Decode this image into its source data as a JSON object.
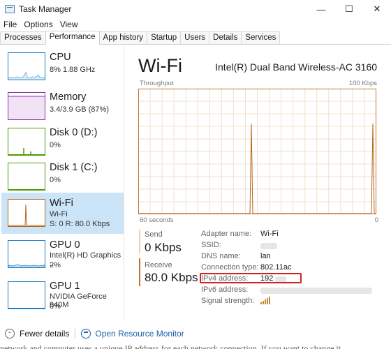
{
  "window": {
    "title": "Task Manager",
    "minimize_label": "—",
    "maximize_label": "☐",
    "close_label": "✕"
  },
  "menu": [
    "File",
    "Options",
    "View"
  ],
  "tabs": [
    "Processes",
    "Performance",
    "App history",
    "Startup",
    "Users",
    "Details",
    "Services"
  ],
  "active_tab": "Performance",
  "sidebar": {
    "items": [
      {
        "name": "CPU",
        "line1": "8%  1.88 GHz",
        "line2": "",
        "color": "#1f7fc6"
      },
      {
        "name": "Memory",
        "line1": "3.4/3.9 GB (87%)",
        "line2": "",
        "color": "#8b31a8"
      },
      {
        "name": "Disk 0 (D:)",
        "line1": "0%",
        "line2": "",
        "color": "#4e9a06"
      },
      {
        "name": "Disk 1 (C:)",
        "line1": "0%",
        "line2": "",
        "color": "#4e9a06"
      },
      {
        "name": "Wi-Fi",
        "line1": "Wi-Fi",
        "line2": "S: 0 R: 80.0 Kbps",
        "color": "#b5661a"
      },
      {
        "name": "GPU 0",
        "line1": "Intel(R) HD Graphics ...",
        "line2": "2%",
        "color": "#1f7fc6"
      },
      {
        "name": "GPU 1",
        "line1": "NVIDIA GeForce 940M",
        "line2": "0%",
        "color": "#1f7fc6"
      }
    ],
    "selected": "Wi-Fi"
  },
  "main": {
    "title": "Wi-Fi",
    "adapter": "Intel(R) Dual Band Wireless-AC 3160",
    "throughput_label": "Throughput",
    "throughput_max": "100 Kbps",
    "time_left": "60 seconds",
    "time_right": "0",
    "accent": "#c2742a",
    "grid_color": "#f1e0cc",
    "send_label": "Send",
    "send_value": "0 Kbps",
    "receive_label": "Receive",
    "receive_value": "80.0 Kbps",
    "properties": [
      {
        "key": "Adapter name:",
        "value": "Wi-Fi"
      },
      {
        "key": "SSID:",
        "value": ""
      },
      {
        "key": "DNS name:",
        "value": "lan"
      },
      {
        "key": "Connection type:",
        "value": "802.11ac"
      },
      {
        "key": "IPv4 address:",
        "value": "192"
      },
      {
        "key": "IPv6 address:",
        "value": ""
      },
      {
        "key": "Signal strength:",
        "value": ""
      }
    ]
  },
  "chart_data": {
    "type": "line",
    "title": "",
    "xlabel": "",
    "ylabel": "Throughput",
    "x_range_label": [
      "60 seconds",
      "0"
    ],
    "ylim": [
      0,
      100
    ],
    "series": [
      {
        "values": [
          0,
          0,
          0,
          0,
          0,
          0,
          0,
          0,
          0,
          0,
          0,
          0,
          0,
          0,
          0,
          0,
          0,
          0,
          0,
          0,
          0,
          0,
          0,
          0,
          0,
          0,
          0,
          0,
          0,
          0,
          0,
          0,
          0,
          0,
          0,
          0,
          0,
          0,
          0,
          0,
          0,
          0,
          0,
          0,
          0,
          0,
          0,
          0,
          0,
          0,
          0,
          0,
          0,
          0,
          0,
          0,
          0,
          0,
          0,
          0,
          0
        ]
      }
    ]
  },
  "footer": {
    "fewer_details": "Fewer details",
    "open_resource_monitor": "Open Resource Monitor"
  },
  "bottom_text": "network and computer uses a unique IP address for each network connection. If you want to change it"
}
